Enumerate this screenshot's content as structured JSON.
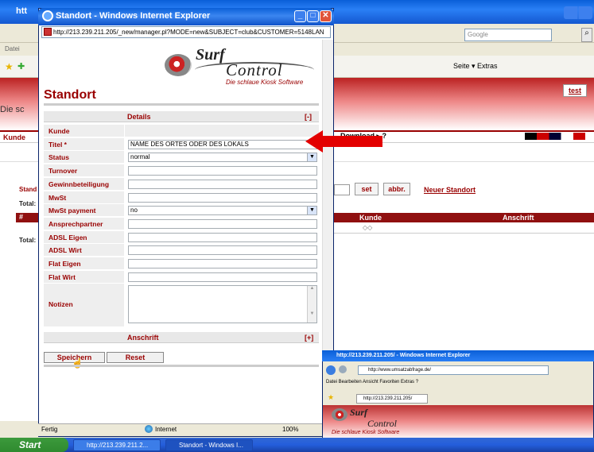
{
  "background_window": {
    "title": "http://213.239.211.205/ - Windows Internet Explorer",
    "title_visible": "htt",
    "search_placeholder": "Google",
    "menu_label": "Datei",
    "toolbar_right": "Seite ▾  Extras",
    "banner_left_text": "Die sc",
    "test_button": "test",
    "nav_left": "Kunde",
    "download_label": "Download ▸ ?",
    "stand_label": "Stand",
    "total_label_1": "Total:",
    "hash_label": "#",
    "total_label_2": "Total:",
    "set_button": "set",
    "abbr_button": "abbr.",
    "neuer_standort_link": "Neuer Standort",
    "table_headers": [
      "Kunde",
      "Anschrift"
    ],
    "table_cell_icon": "◇◇"
  },
  "popup": {
    "title": "Standort - Windows Internet Explorer",
    "address": "http://213.239.211.205/_new/manager.pl?MODE=new&SUBJECT=club&CUSTOMER=5148LAN",
    "logo": {
      "surf": "Surf",
      "control": "Control",
      "tagline": "Die schlaue Kiosk Software"
    },
    "heading": "Standort",
    "section_details": "Details",
    "section_details_toggle": "[-]",
    "fields": [
      {
        "label": "Kunde",
        "value": "",
        "kind": "static"
      },
      {
        "label": "Titel *",
        "value": "NAME DES ORTES ODER DES LOKALS",
        "kind": "text"
      },
      {
        "label": "Status",
        "value": "normal",
        "kind": "select"
      },
      {
        "label": "Turnover",
        "value": "",
        "kind": "text"
      },
      {
        "label": "Gewinnbeteiligung",
        "value": "",
        "kind": "text"
      },
      {
        "label": "MwSt",
        "value": "",
        "kind": "text"
      },
      {
        "label": "MwSt payment",
        "value": "no",
        "kind": "select"
      },
      {
        "label": "Ansprechpartner",
        "value": "",
        "kind": "text"
      },
      {
        "label": "ADSL Eigen",
        "value": "",
        "kind": "text"
      },
      {
        "label": "ADSL Wirt",
        "value": "",
        "kind": "text"
      },
      {
        "label": "Flat Eigen",
        "value": "",
        "kind": "text"
      },
      {
        "label": "Flat Wirt",
        "value": "",
        "kind": "text"
      }
    ],
    "notizen_label": "Notizen",
    "section_anschrift": "Anschrift",
    "section_anschrift_toggle": "[+]",
    "save_button": "Speichern",
    "reset_button": "Reset",
    "status_text": "Fertig",
    "status_zone": "Internet",
    "status_zoom": "100%"
  },
  "taskbar": {
    "start": "Start",
    "task1": "http://213.239.211.2...",
    "task2": "Standort - Windows I..."
  },
  "inset_window": {
    "title": "http://213.239.211.205/ - Windows Internet Explorer",
    "address": "http://www.umsatzabfrage.de/",
    "menu": "Datei  Bearbeiten  Ansicht  Favoriten  Extras  ?",
    "tab": "http://213.239.211.205/",
    "logo_surf": "Surf",
    "logo_control": "Control",
    "tagline": "Die schlaue Kiosk Software"
  },
  "colors": {
    "accent_red": "#990000",
    "arrow_red": "#e30000",
    "xp_blue": "#0a5fd8"
  }
}
